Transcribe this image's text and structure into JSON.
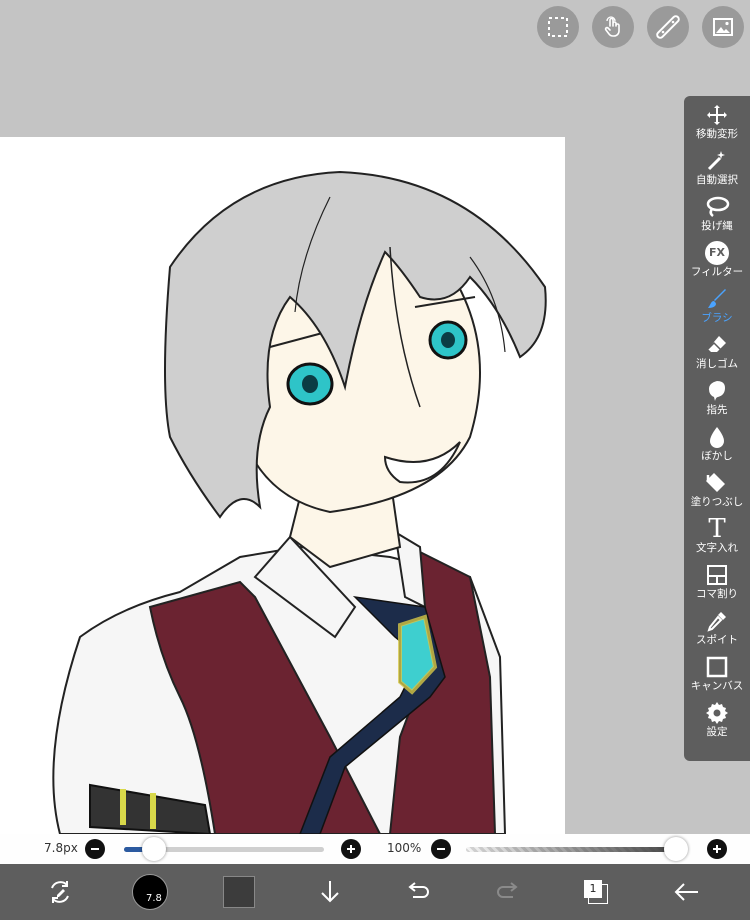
{
  "top_buttons": [
    {
      "icon": "selection-icon"
    },
    {
      "icon": "touch-gesture-icon"
    },
    {
      "icon": "ruler-icon"
    },
    {
      "icon": "image-icon"
    }
  ],
  "tools": [
    {
      "label": "移動変形",
      "icon": "move-icon",
      "active": false
    },
    {
      "label": "自動選択",
      "icon": "magic-wand-icon",
      "active": false
    },
    {
      "label": "投げ縄",
      "icon": "lasso-icon",
      "active": false
    },
    {
      "label": "フィルター",
      "icon": "fx-icon",
      "icon_text": "FX",
      "active": false
    },
    {
      "label": "ブラシ",
      "icon": "brush-icon",
      "active": true
    },
    {
      "label": "消しゴム",
      "icon": "eraser-icon",
      "active": false
    },
    {
      "label": "指先",
      "icon": "smudge-icon",
      "active": false
    },
    {
      "label": "ぼかし",
      "icon": "blur-drop-icon",
      "active": false
    },
    {
      "label": "塗りつぶし",
      "icon": "fill-bucket-icon",
      "active": false
    },
    {
      "label": "文字入れ",
      "icon": "text-icon",
      "icon_text": "T",
      "active": false
    },
    {
      "label": "コマ割り",
      "icon": "frame-divider-icon",
      "active": false
    },
    {
      "label": "スポイト",
      "icon": "eyedropper-icon",
      "active": false
    },
    {
      "label": "キャンバス",
      "icon": "canvas-icon",
      "active": false
    },
    {
      "label": "設定",
      "icon": "gear-icon",
      "active": false
    }
  ],
  "brush_size": {
    "label": "7.8px",
    "value_fraction": 0.13
  },
  "opacity": {
    "label": "100%",
    "value_fraction": 1.0
  },
  "bottom": {
    "color_swatch_label": "7.8",
    "layer_count": "1"
  },
  "colors": {
    "accent": "#4aa3ff",
    "toolbar": "#5e5e5e",
    "slider_fill": "#2c5aa0",
    "secondary_color": "#3c3c3c"
  }
}
